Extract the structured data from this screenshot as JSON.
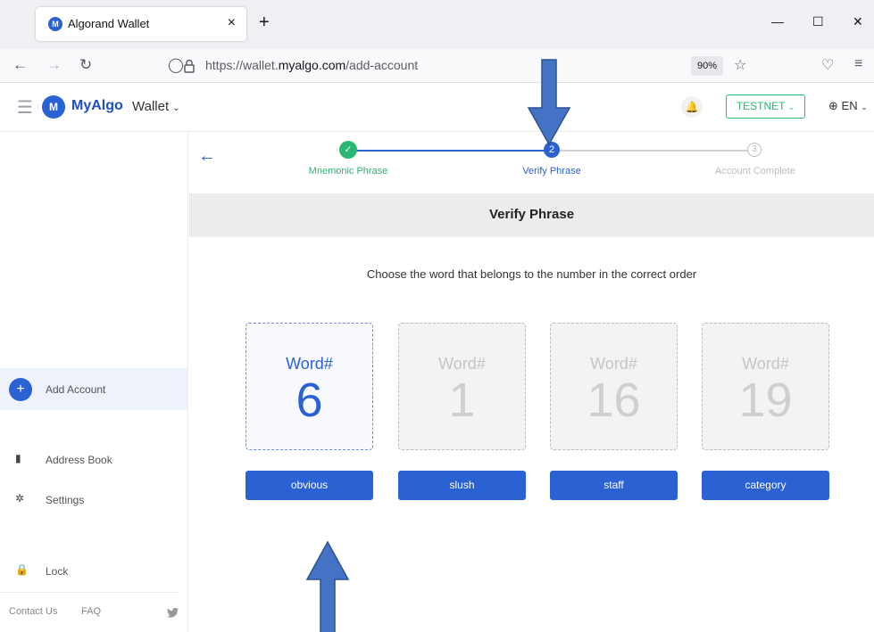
{
  "browser": {
    "tab_title": "Algorand Wallet",
    "tab_close": "×",
    "new_tab": "+",
    "url_prefix": "https://wallet.",
    "url_domain": "myalgo.com",
    "url_suffix": "/add-account",
    "zoom": "90%"
  },
  "header": {
    "logo_text": "MyAlgo",
    "logo_sub": "Wallet",
    "network": "TESTNET",
    "language": "EN"
  },
  "sidebar": {
    "add_account": "Add Account",
    "address_book": "Address Book",
    "settings": "Settings",
    "lock": "Lock",
    "contact_us": "Contact Us",
    "faq": "FAQ"
  },
  "stepper": {
    "steps": [
      {
        "label": "Mnemonic Phrase",
        "marker": "✓",
        "state": "done"
      },
      {
        "label": "Verify Phrase",
        "marker": "2",
        "state": "current"
      },
      {
        "label": "Account Complete",
        "marker": "3",
        "state": "pending"
      }
    ]
  },
  "verify": {
    "title": "Verify Phrase",
    "instruction": "Choose the word that belongs to the number in the correct order",
    "cards": [
      {
        "label": "Word#",
        "number": "6",
        "active": true
      },
      {
        "label": "Word#",
        "number": "1",
        "active": false
      },
      {
        "label": "Word#",
        "number": "16",
        "active": false
      },
      {
        "label": "Word#",
        "number": "19",
        "active": false
      }
    ],
    "words": [
      "obvious",
      "slush",
      "staff",
      "category"
    ]
  },
  "colors": {
    "primary": "#2a62d4",
    "success": "#2ab673",
    "annotation_arrow": "#4472c4"
  }
}
